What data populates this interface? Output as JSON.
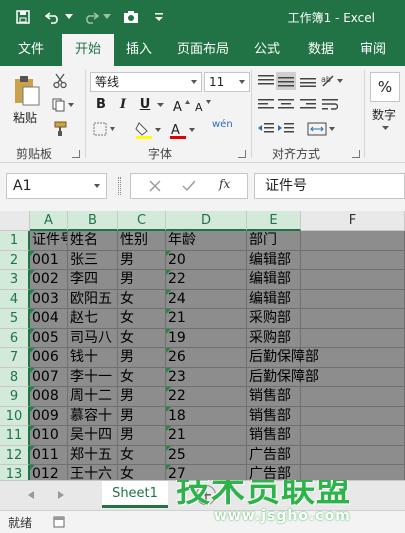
{
  "titlebar": {
    "title": "工作簿1 - Excel"
  },
  "tabs": [
    {
      "label": "文件",
      "active": false
    },
    {
      "label": "开始",
      "active": true
    },
    {
      "label": "插入",
      "active": false
    },
    {
      "label": "页面布局",
      "active": false
    },
    {
      "label": "公式",
      "active": false
    },
    {
      "label": "数据",
      "active": false
    },
    {
      "label": "审阅",
      "active": false
    }
  ],
  "ribbon": {
    "paste_label": "粘贴",
    "clipboard_label": "剪贴板",
    "font_name": "等线",
    "font_size": "11",
    "bold": "B",
    "italic": "I",
    "underline": "U",
    "font_group_label": "字体",
    "align_group_label": "对齐方式",
    "percent": "%",
    "number_label": "数字",
    "wen_label": "wén"
  },
  "formula_bar": {
    "name_box": "A1",
    "fx": "fx",
    "formula": "证件号"
  },
  "grid": {
    "columns": [
      "A",
      "B",
      "C",
      "D",
      "E",
      "F"
    ],
    "rows": [
      "1",
      "2",
      "3",
      "4",
      "5",
      "6",
      "7",
      "8",
      "9",
      "10",
      "11",
      "12",
      "13"
    ],
    "cells": [
      [
        "证件号",
        "姓名",
        "性别",
        "年龄",
        "部门"
      ],
      [
        "001",
        "张三",
        "男",
        "20",
        "编辑部"
      ],
      [
        "002",
        "李四",
        "男",
        "22",
        "编辑部"
      ],
      [
        "003",
        "欧阳五",
        "女",
        "24",
        "编辑部"
      ],
      [
        "004",
        "赵七",
        "女",
        "21",
        "采购部"
      ],
      [
        "005",
        "司马八",
        "女",
        "19",
        "采购部"
      ],
      [
        "006",
        "钱十",
        "男",
        "26",
        "后勤保障部"
      ],
      [
        "007",
        "李十一",
        "女",
        "23",
        "后勤保障部"
      ],
      [
        "008",
        "周十二",
        "男",
        "22",
        "销售部"
      ],
      [
        "009",
        "慕容十",
        "男",
        "18",
        "销售部"
      ],
      [
        "010",
        "吴十四",
        "男",
        "21",
        "销售部"
      ],
      [
        "011",
        "郑十五",
        "女",
        "25",
        "广告部"
      ],
      [
        "012",
        "王十六",
        "女",
        "27",
        "广告部"
      ]
    ]
  },
  "sheets": {
    "active": "Sheet1",
    "add": "+"
  },
  "status": {
    "ready": "就绪"
  },
  "watermark": {
    "main": "技术员联盟",
    "url": "www.jsgho.com"
  },
  "colors": {
    "brand": "#217346",
    "selection_fill": "#8d8d8d",
    "watermark": "#2db34a"
  }
}
